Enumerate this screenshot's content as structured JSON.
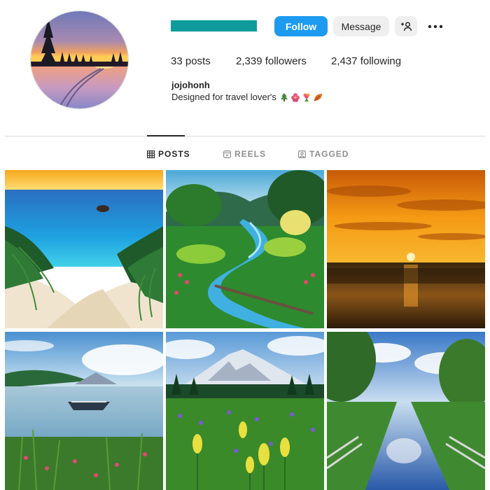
{
  "profile": {
    "name": "jojohonh",
    "bio": "Designed for travel lover's",
    "bio_emojis": [
      "evergreen-tree-icon",
      "hibiscus-icon",
      "bouquet-icon",
      "fallen-leaf-icon"
    ],
    "username_bar_color": "#0f9b9b"
  },
  "actions": {
    "follow_label": "Follow",
    "message_label": "Message",
    "add_user_icon": "add-user-icon",
    "more_icon": "more-options-icon"
  },
  "stats": {
    "posts": "33",
    "posts_label": "posts",
    "followers": "2,339",
    "followers_label": "followers",
    "following": "2,437",
    "following_label": "following"
  },
  "tabs": [
    {
      "label": "POSTS",
      "icon": "grid-icon",
      "active": true
    },
    {
      "label": "REELS",
      "icon": "reels-icon",
      "active": false
    },
    {
      "label": "TAGGED",
      "icon": "tagged-icon",
      "active": false
    }
  ],
  "posts": [
    {
      "subject": "tropical beach"
    },
    {
      "subject": "forest river"
    },
    {
      "subject": "sunset over sea"
    },
    {
      "subject": "lake with boat"
    },
    {
      "subject": "mountain wildflowers"
    },
    {
      "subject": "canal reflection"
    }
  ],
  "colors": {
    "accent": "#1d9bf0",
    "secondary_button": "#efefef",
    "divider": "#dbdbdb",
    "muted_text": "#8e8e8e"
  }
}
